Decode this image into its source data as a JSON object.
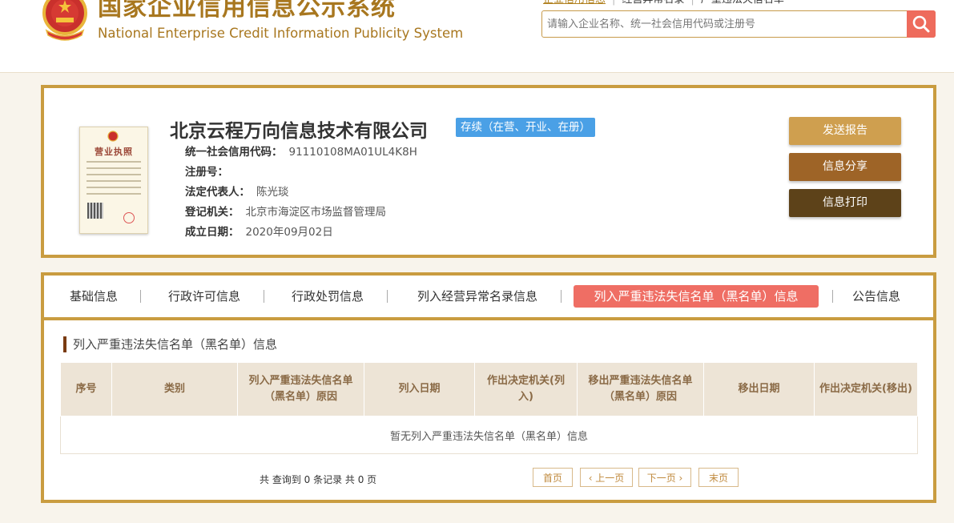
{
  "header": {
    "title_cn": "国家企业信用信息公示系统",
    "title_en": "National Enterprise Credit Information Publicity System",
    "top_links": [
      "企业信用信息",
      "经营异常名录",
      "严重违法失信名单"
    ],
    "search_placeholder": "请输入企业名称、统一社会信用代码或注册号"
  },
  "company": {
    "license_title": "营业执照",
    "name": "北京云程万向信息技术有限公司",
    "status": "存续（在营、开业、在册）",
    "fields": [
      {
        "label": "统一社会信用代码：",
        "value": "91110108MA01UL4K8H"
      },
      {
        "label": "注册号：",
        "value": ""
      },
      {
        "label": "法定代表人：",
        "value": "陈光琰"
      },
      {
        "label": "登记机关：",
        "value": "北京市海淀区市场监督管理局"
      },
      {
        "label": "成立日期：",
        "value": "2020年09月02日"
      }
    ],
    "actions": {
      "send_report": "发送报告",
      "share": "信息分享",
      "print": "信息打印"
    }
  },
  "tabs": [
    {
      "label": "基础信息"
    },
    {
      "label": "行政许可信息"
    },
    {
      "label": "行政处罚信息"
    },
    {
      "label": "列入经营异常名录信息"
    },
    {
      "label": "列入严重违法失信名单（黑名单）信息"
    },
    {
      "label": "公告信息"
    }
  ],
  "section": {
    "title": "列入严重违法失信名单（黑名单）信息",
    "columns": [
      "序号",
      "类别",
      "列入严重违法失信名单（黑名单）原因",
      "列入日期",
      "作出决定机关(列入)",
      "移出严重违法失信名单（黑名单）原因",
      "移出日期",
      "作出决定机关(移出)"
    ],
    "empty_text": "暂无列入严重违法失信名单（黑名单）信息",
    "summary": "共 查询到 0 条记录 共 0 页",
    "pager": {
      "first": "首页",
      "prev": "‹ 上一页",
      "next": "下一页 ›",
      "last": "末页"
    }
  },
  "colors": {
    "brand_gold": "#c99c40",
    "active_tab": "#ef6e64",
    "status_blue": "#4aa0e6",
    "btn_send": "#cf9f4f",
    "btn_share": "#9e6427",
    "btn_print": "#5d4219"
  },
  "icons": [
    "national-emblem-icon",
    "search-icon"
  ]
}
